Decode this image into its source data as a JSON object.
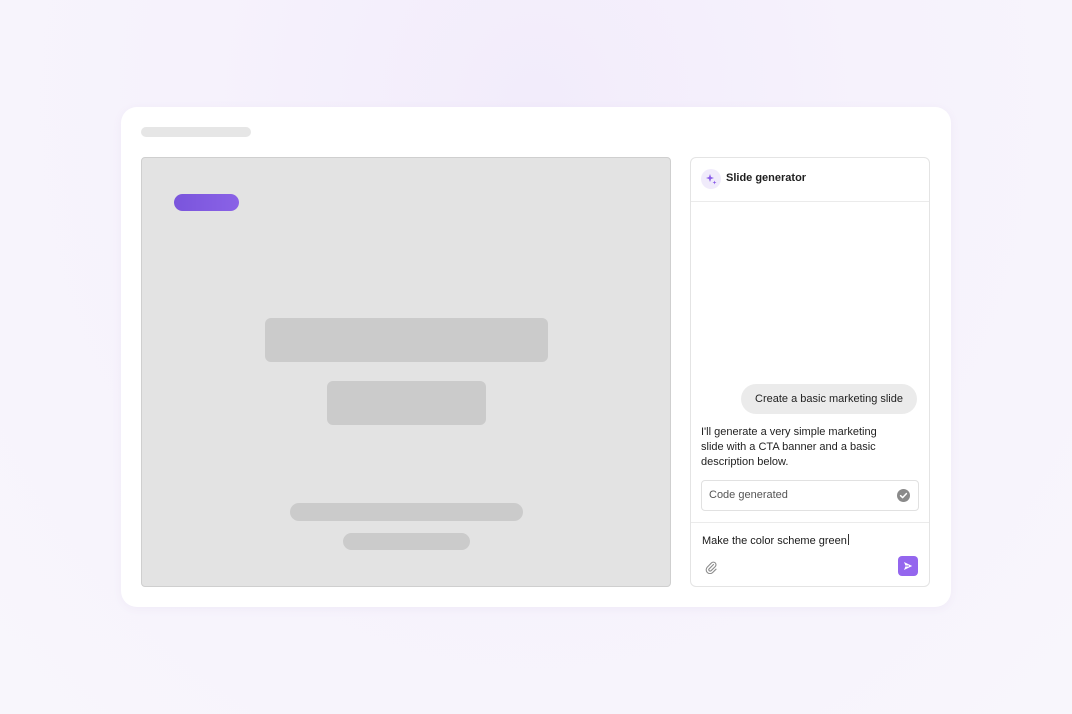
{
  "chat": {
    "title": "Slide generator",
    "messages": {
      "user": "Create a basic marketing slide",
      "assistant": "I'll generate a very simple marketing slide with a CTA banner and a basic description below."
    },
    "code_status": {
      "label": "Code generated",
      "icon": "check-circle-icon"
    },
    "input": {
      "value": "Make the color scheme green"
    },
    "icons": {
      "header": "sparkle-icon",
      "attach": "paperclip-icon",
      "send": "send-icon"
    }
  },
  "colors": {
    "accent": "#9466ee",
    "cta_pill": "#7a55dc",
    "placeholder": "#cbcbcb",
    "canvas": "#e3e3e3"
  }
}
